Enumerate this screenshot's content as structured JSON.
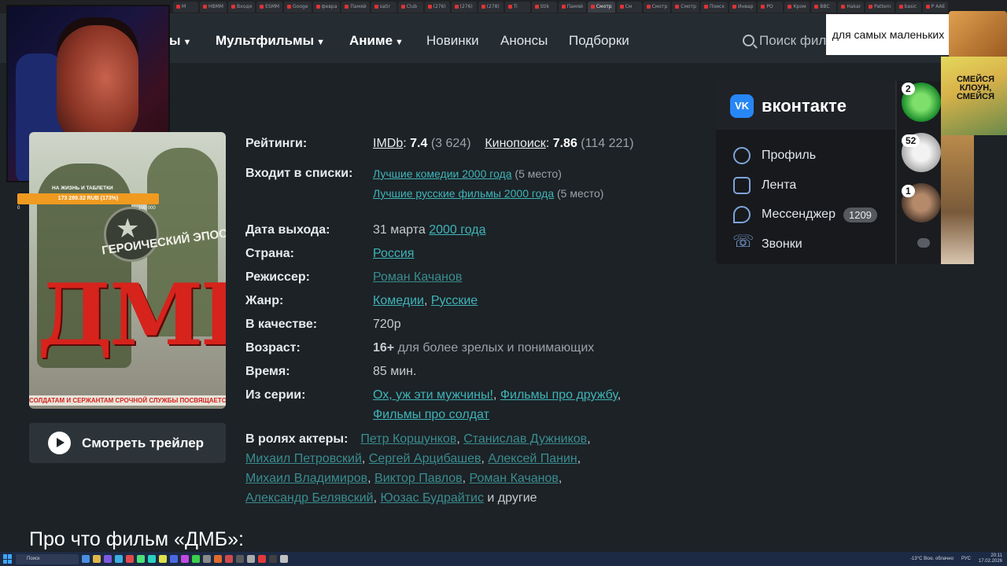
{
  "browser": {
    "tabs": [
      "М",
      "HBMM",
      "Входя",
      "ESMM",
      "Googe",
      "февра",
      "Памяй",
      "satir",
      "Club",
      "(276)",
      "(276)",
      "(278)",
      "Ti",
      "Stik",
      "Памяй",
      "Смотр",
      "Cм",
      "Смотр",
      "Смотр",
      "Поиск",
      "Инвар",
      "РО",
      "Кром",
      "BBC",
      "Hakar",
      "Pattern",
      "basic",
      "Р AAE"
    ]
  },
  "site_nav": {
    "items": [
      {
        "label": "ы",
        "chevron": "chevron-down-icon"
      },
      {
        "label": "Мультфильмы",
        "chevron": "chevron-down-icon"
      },
      {
        "label": "Аниме",
        "chevron": "chevron-down-icon"
      },
      {
        "label": "Новинки"
      },
      {
        "label": "Анонсы"
      },
      {
        "label": "Подборки"
      }
    ],
    "search_placeholder": "Поиск фил"
  },
  "donation": {
    "title": "НА ЖИЗНЬ И ТАБЛЕТКИ",
    "amount": "173 289.32 RUB (173%)",
    "min": "0",
    "max": "100 000",
    "progress": 1.0
  },
  "poster": {
    "epos": "ГЕРОИЧЕСКИЙ ЭПОС",
    "logo": "ДМБ",
    "tagline": "СОЛДАТАМ И СЕРЖАНТАМ СРОЧНОЙ СЛУЖБЫ ПОСВЯЩАЕТСЯ"
  },
  "trailer_button": "Смотреть трейлер",
  "info": {
    "ratings_label": "Рейтинги:",
    "imdb_name": "IMDb",
    "imdb_score": "7.4",
    "imdb_votes": "(3 624)",
    "kp_name": "Кинопоиск",
    "kp_score": "7.86",
    "kp_votes": "(114 221)",
    "lists_label": "Входит в списки:",
    "list1": "Лучшие комедии 2000 года",
    "list1_pos": "(5 место)",
    "list2": "Лучшие русские фильмы 2000 года",
    "list2_pos": "(5 место)",
    "release_label": "Дата выхода:",
    "release_day": "31 марта",
    "release_year": "2000 года",
    "country_label": "Страна:",
    "country": "Россия",
    "director_label": "Режиссер:",
    "director": "Роман Качанов",
    "genre_label": "Жанр:",
    "genre1": "Комедии",
    "genre2": "Русские",
    "quality_label": "В качестве:",
    "quality": "720p",
    "age_label": "Возраст:",
    "age": "16+",
    "age_desc": "для более зрелых и понимающих",
    "time_label": "Время:",
    "time": "85 мин.",
    "series_label": "Из серии:",
    "series1": "Ох, уж эти мужчины!",
    "series2": "Фильмы про дружбу",
    "series3": "Фильмы про солдат",
    "cast_label": "В ролях актеры:",
    "cast": [
      "Петр Коршунков",
      "Станислав Дужников",
      "Михаил Петровский",
      "Сергей Арцибашев",
      "Алексей Панин",
      "Михаил Владимиров",
      "Виктор Павлов",
      "Роман Качанов",
      "Александр Белявский",
      "Юозас Будрайтис"
    ],
    "cast_more": "и другие"
  },
  "section_title": "Про что фильм «ДМБ»:",
  "vk": {
    "title": "вконтакте",
    "logo": "VK",
    "menu": [
      {
        "label": "Профиль",
        "icon": "profile-icon"
      },
      {
        "label": "Лента",
        "icon": "feed-icon"
      },
      {
        "label": "Мессенджер",
        "icon": "messenger-icon",
        "badge": "1209"
      },
      {
        "label": "Звонки",
        "icon": "phone-icon"
      }
    ],
    "avatars": [
      {
        "badge": "2"
      },
      {
        "badge": "52"
      },
      {
        "badge": "1"
      }
    ]
  },
  "overlays": {
    "label": "для самых маленьких",
    "clown": "СМЕЙСЯ КЛОУН, СМЕЙСЯ"
  },
  "taskbar": {
    "search": "Поиск",
    "weather": "-13°C  Всю. облачно",
    "lang": "РУС",
    "time": "20:11",
    "date": "17.02.2026"
  },
  "colors": {
    "page_bg": "#1c2226",
    "link": "#3fb4b9",
    "vk_blue": "#2787f5",
    "donation_orange": "#f09a20"
  }
}
